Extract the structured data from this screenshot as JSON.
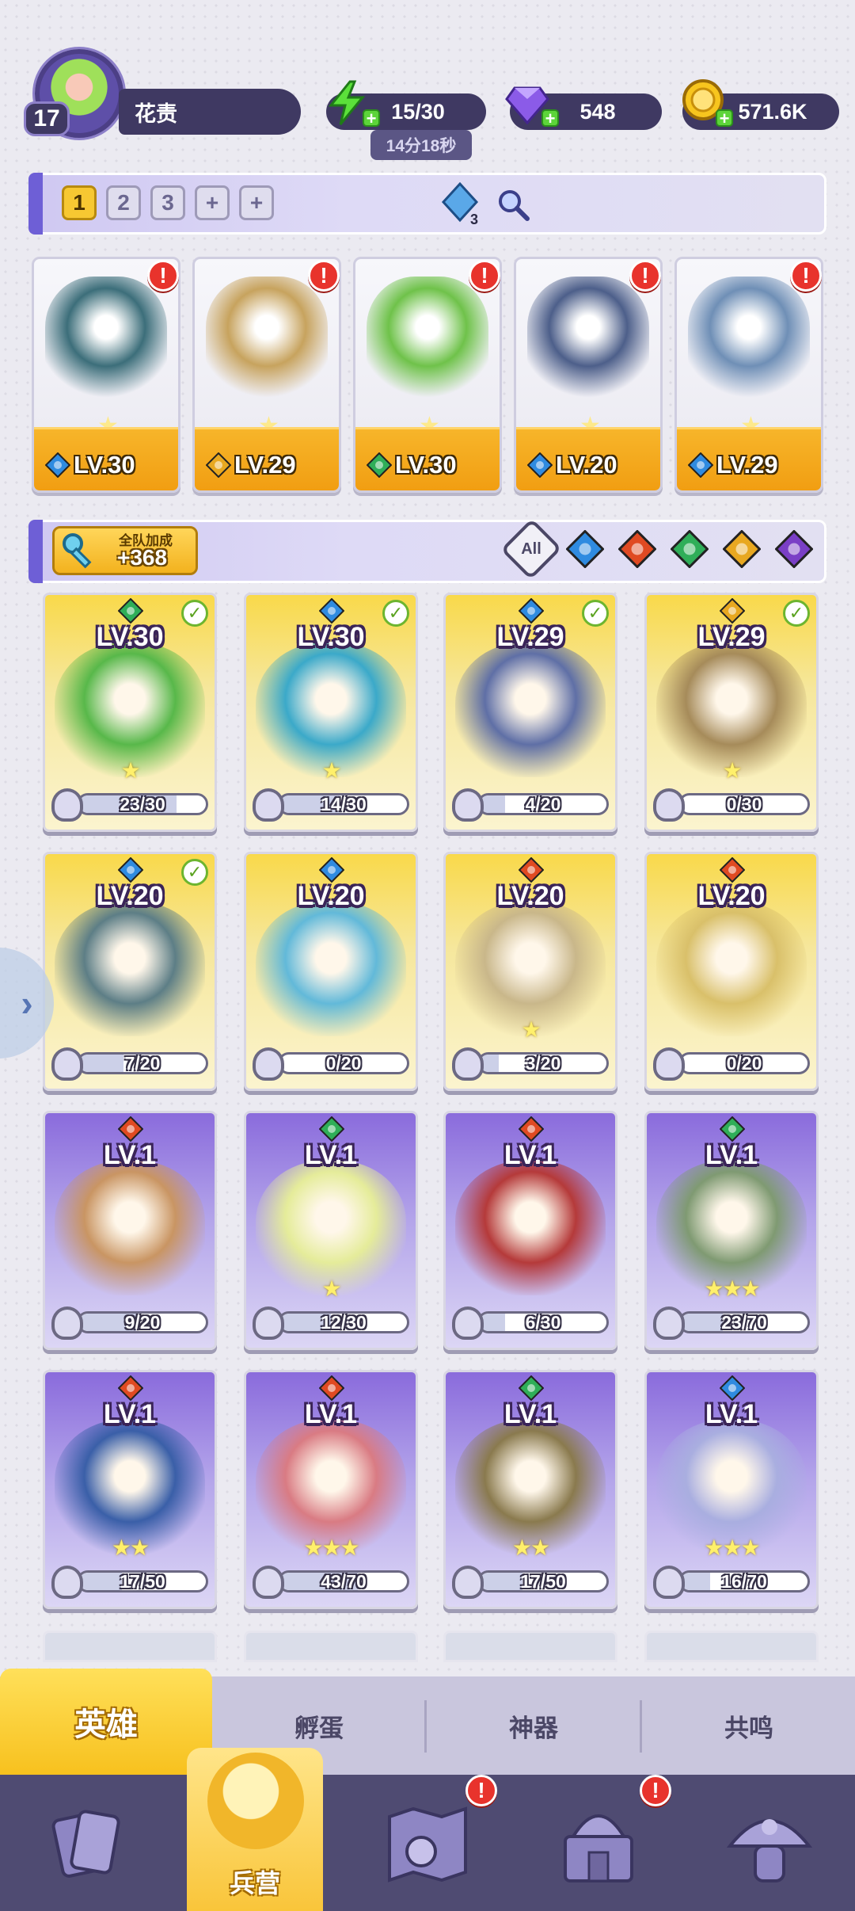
{
  "profile": {
    "level": "17",
    "name": "花责"
  },
  "resources": {
    "energy": {
      "value": "15/30",
      "timer": "14分18秒",
      "icon": "lightning-icon"
    },
    "gems": {
      "value": "548",
      "icon": "gem-icon"
    },
    "coins": {
      "value": "571.6K",
      "icon": "coin-icon"
    }
  },
  "team_tabs": {
    "tab1": "1",
    "tab2": "2",
    "tab3": "3",
    "add1": "+",
    "add2": "+"
  },
  "team_cost": "3",
  "team": [
    {
      "level": "LV.30",
      "element": "water",
      "elem_color": "#2f8be0"
    },
    {
      "level": "LV.29",
      "element": "light",
      "elem_color": "#e8a820"
    },
    {
      "level": "LV.30",
      "element": "wind",
      "elem_color": "#2fae58"
    },
    {
      "level": "LV.20",
      "element": "water",
      "elem_color": "#2f8be0"
    },
    {
      "level": "LV.29",
      "element": "water",
      "elem_color": "#2f8be0"
    }
  ],
  "team_art_colors": [
    "#3c6e7a",
    "#c7a35e",
    "#6fc24a",
    "#4d5f8a",
    "#6f8fb6"
  ],
  "bonus": {
    "label": "全队加成",
    "value": "+368"
  },
  "filters": {
    "all": "All"
  },
  "heroes": [
    {
      "level": "LV.30",
      "progress": "23/30",
      "pct": 0.767,
      "frame": "gold",
      "element": "wind",
      "check": true,
      "art": "#58b84a",
      "stars": "★"
    },
    {
      "level": "LV.30",
      "progress": "14/30",
      "pct": 0.467,
      "frame": "gold",
      "element": "water",
      "check": true,
      "art": "#3ba9c9",
      "stars": "★"
    },
    {
      "level": "LV.29",
      "progress": "4/20",
      "pct": 0.2,
      "frame": "gold",
      "element": "water",
      "check": true,
      "art": "#5f6fa6",
      "stars": ""
    },
    {
      "level": "LV.29",
      "progress": "0/30",
      "pct": 0.0,
      "frame": "gold",
      "element": "light",
      "check": true,
      "art": "#a68b5a",
      "stars": "★"
    },
    {
      "level": "LV.20",
      "progress": "7/20",
      "pct": 0.35,
      "frame": "gold",
      "element": "water",
      "check": true,
      "art": "#5d7e86",
      "stars": ""
    },
    {
      "level": "LV.20",
      "progress": "0/20",
      "pct": 0.0,
      "frame": "gold",
      "element": "water",
      "check": false,
      "art": "#62b9d9",
      "stars": ""
    },
    {
      "level": "LV.20",
      "progress": "3/20",
      "pct": 0.15,
      "frame": "gold",
      "element": "fire",
      "check": false,
      "art": "#c9b78a",
      "stars": "★"
    },
    {
      "level": "LV.20",
      "progress": "0/20",
      "pct": 0.0,
      "frame": "gold",
      "element": "fire",
      "check": false,
      "art": "#d9c06a",
      "stars": ""
    },
    {
      "level": "LV.1",
      "progress": "9/20",
      "pct": 0.45,
      "frame": "purple",
      "element": "fire",
      "check": false,
      "art": "#c99563",
      "stars": ""
    },
    {
      "level": "LV.1",
      "progress": "12/30",
      "pct": 0.4,
      "frame": "purple",
      "element": "wind",
      "check": false,
      "art": "#e5ec9a",
      "stars": "★"
    },
    {
      "level": "LV.1",
      "progress": "6/30",
      "pct": 0.2,
      "frame": "purple",
      "element": "fire",
      "check": false,
      "art": "#b53a3a",
      "stars": ""
    },
    {
      "level": "LV.1",
      "progress": "23/70",
      "pct": 0.329,
      "frame": "purple",
      "element": "wind",
      "check": false,
      "art": "#7f9a72",
      "stars": "★★★"
    },
    {
      "level": "LV.1",
      "progress": "17/50",
      "pct": 0.34,
      "frame": "purple",
      "element": "fire",
      "check": false,
      "art": "#3a5fa8",
      "stars": "★★"
    },
    {
      "level": "LV.1",
      "progress": "43/70",
      "pct": 0.614,
      "frame": "purple",
      "element": "fire",
      "check": false,
      "art": "#d97b83",
      "stars": "★★★"
    },
    {
      "level": "LV.1",
      "progress": "17/50",
      "pct": 0.34,
      "frame": "purple",
      "element": "wind",
      "check": false,
      "art": "#8a7a4e",
      "stars": "★★"
    },
    {
      "level": "LV.1",
      "progress": "16/70",
      "pct": 0.229,
      "frame": "purple",
      "element": "water",
      "check": false,
      "art": "#a9aee0",
      "stars": "★★★"
    }
  ],
  "element_colors": {
    "water": "#2f8be0",
    "fire": "#e04a22",
    "wind": "#2fae58",
    "light": "#e8a820",
    "dark": "#7a3fc6"
  },
  "subtabs": {
    "heroes": "英雄",
    "hatch": "孵蛋",
    "artifact": "神器",
    "resonance": "共鸣"
  },
  "nav": {
    "barracks": "兵营"
  }
}
